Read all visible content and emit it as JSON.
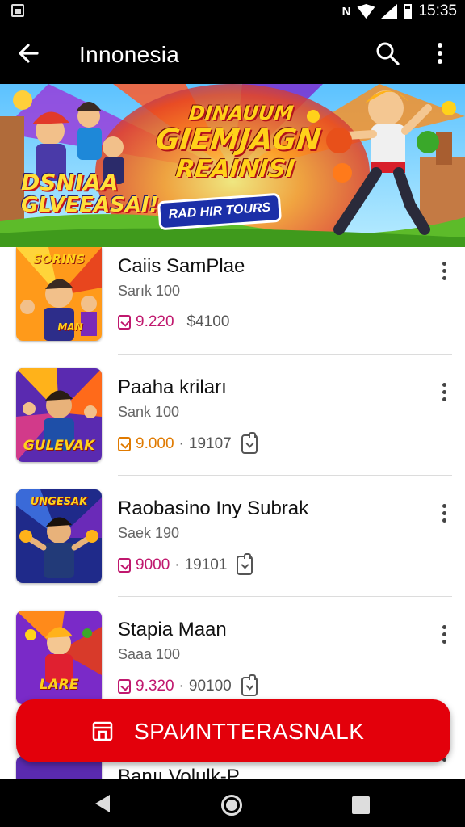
{
  "status_bar": {
    "time": "15:35",
    "nfc_label": "N"
  },
  "app_bar": {
    "title": "Innonesia",
    "icons": [
      "back-arrow-icon",
      "search-icon",
      "more-vert-icon"
    ]
  },
  "banner": {
    "title_line1": "DINAUUM",
    "title_line2": "GIEMJAGN",
    "title_line3": "REAINISI",
    "button_label": "RAD HIR TOURS",
    "logo_line1": "DSNIAA",
    "logo_line2": "GLVEEASAI!"
  },
  "items": [
    {
      "name": "Caiis SamPlae",
      "sub": "Sarık 100",
      "price": "9.220",
      "sep": "",
      "count": "$4100",
      "price_color": "#c0186e",
      "thumb_text": "SORINS",
      "thumb_text2": "MAN",
      "has_dl_icon": false
    },
    {
      "name": "Paaha kriları",
      "sub": "Sank 100",
      "price": "9.000",
      "sep": "·",
      "count": "19107",
      "price_color": "#e07a00",
      "thumb_text": "",
      "thumb_text2": "GULEVAK",
      "has_dl_icon": true
    },
    {
      "name": "Raobasino Iny Subrak",
      "sub": "Saek 190",
      "price": "9000",
      "sep": "·",
      "count": "19101",
      "price_color": "#c0186e",
      "thumb_text": "UNGESAK",
      "thumb_text2": "",
      "has_dl_icon": true
    },
    {
      "name": "Stapia Maan",
      "sub": "Saaa 100",
      "price": "9.320",
      "sep": "·",
      "count": "90100",
      "price_color": "#c0186e",
      "thumb_text": "",
      "thumb_text2": "LARE",
      "has_dl_icon": true
    }
  ],
  "partial_item": {
    "name": "Banıı Volulk-P"
  },
  "cta": {
    "label": "SPAИNTTERASNALK"
  },
  "colors": {
    "accent": "#e3000b",
    "price_pink": "#c0186e",
    "price_orange": "#e07a00"
  }
}
